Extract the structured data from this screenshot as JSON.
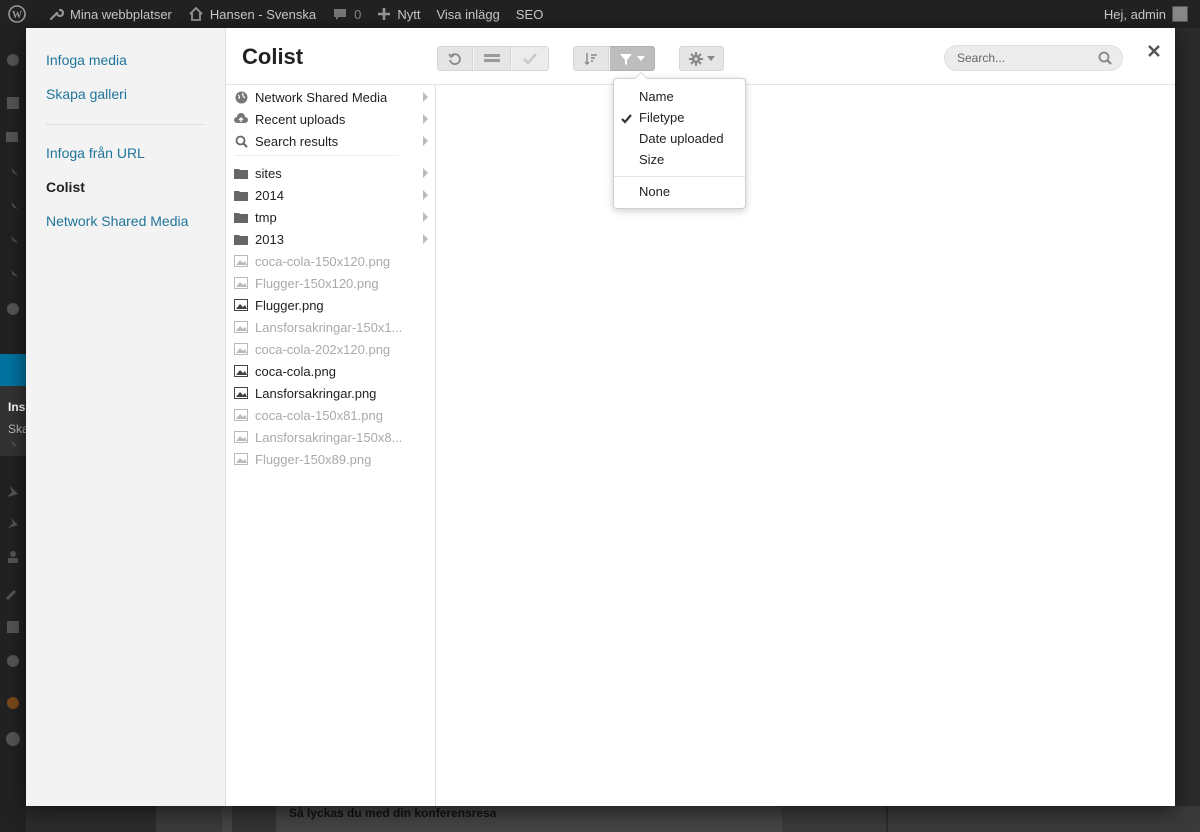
{
  "adminbar": {
    "sites": "Mina webbplatser",
    "site_name": "Hansen - Svenska",
    "comments": "0",
    "new": "Nytt",
    "view": "Visa inlägg",
    "seo": "SEO",
    "greeting": "Hej, admin"
  },
  "sidebar_bg": {
    "sub1": "Ins",
    "sub2": "Ska"
  },
  "bg_page": {
    "post_title": "Så lyckas du med din konferensresa"
  },
  "menu": {
    "items": [
      "Infoga media",
      "Skapa galleri",
      "Infoga från URL",
      "Colist",
      "Network Shared Media"
    ],
    "active": "Colist"
  },
  "title": "Colist",
  "search": {
    "placeholder": "Search..."
  },
  "sources": [
    {
      "label": "Network Shared Media",
      "icon": "globe-icon"
    },
    {
      "label": "Recent uploads",
      "icon": "cloud-upload-icon"
    },
    {
      "label": "Search results",
      "icon": "search-icon"
    }
  ],
  "folders": [
    "sites",
    "2014",
    "tmp",
    "2013"
  ],
  "files": [
    {
      "label": "coca-cola-150x120.png",
      "dim": true
    },
    {
      "label": "Flugger-150x120.png",
      "dim": true
    },
    {
      "label": "Flugger.png",
      "dim": false
    },
    {
      "label": "Lansforsakringar-150x1...",
      "dim": true
    },
    {
      "label": "coca-cola-202x120.png",
      "dim": true
    },
    {
      "label": "coca-cola.png",
      "dim": false
    },
    {
      "label": "Lansforsakringar.png",
      "dim": false
    },
    {
      "label": "coca-cola-150x81.png",
      "dim": true
    },
    {
      "label": "Lansforsakringar-150x8...",
      "dim": true
    },
    {
      "label": "Flugger-150x89.png",
      "dim": true
    }
  ],
  "filter_menu": {
    "items": [
      "Name",
      "Filetype",
      "Date uploaded",
      "Size"
    ],
    "checked": "Filetype",
    "none": "None"
  },
  "colors": {
    "link": "#21759b",
    "adminbar": "#222222",
    "active": "#0074a2"
  }
}
